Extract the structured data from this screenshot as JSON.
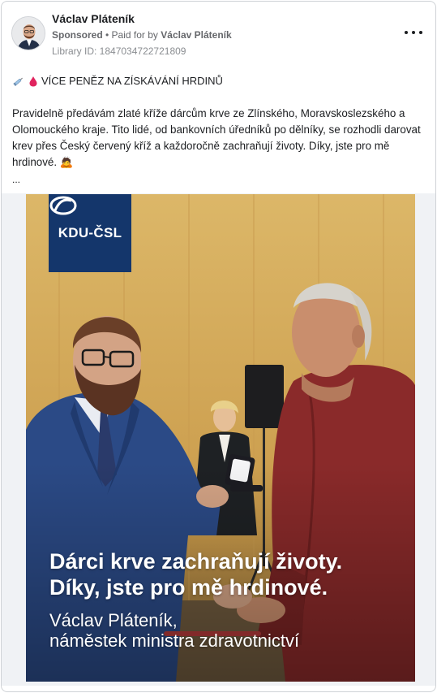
{
  "post": {
    "page_name": "Václav Pláteník",
    "sponsored": "Sponsored",
    "paid_for_prefix": "• Paid for by",
    "paid_for_name": "Václav Pláteník",
    "library_id": "Library ID: 1847034722721809",
    "more_icon": "more-horizontal-icon"
  },
  "content": {
    "headline_icons": [
      "syringe-icon",
      "blood-drop-icon"
    ],
    "headline": "VÍCE PENĚZ NA ZÍSKÁVÁNÍ HRDINŮ",
    "body": "Pravidelně předávám zlaté kříže dárcům krve ze Zlínského, Moravskoslezského a Olomouckého kraje. Tito lidé, od bankovních úředníků po dělníky, se rozhodli darovat krev přes Český červený kříž a každoročně zachraňují životy. Díky, jste pro mě hrdinové.",
    "body_emoji": "🙇",
    "more_indicator": "..."
  },
  "creative": {
    "logo_text": "KDU-ČSL",
    "title_line1": "Dárci krve zachraňují životy.",
    "title_line2": "Díky, jste pro mě hrdinové.",
    "signature_line1": "Václav Pláteník,",
    "signature_line2": "náměstek ministra zdravotnictví",
    "colors": {
      "logo_bg": "#14366b",
      "wall": "#d4ad5c",
      "suit": "#2b4a86",
      "shirt_red": "#8a2a2a"
    }
  }
}
